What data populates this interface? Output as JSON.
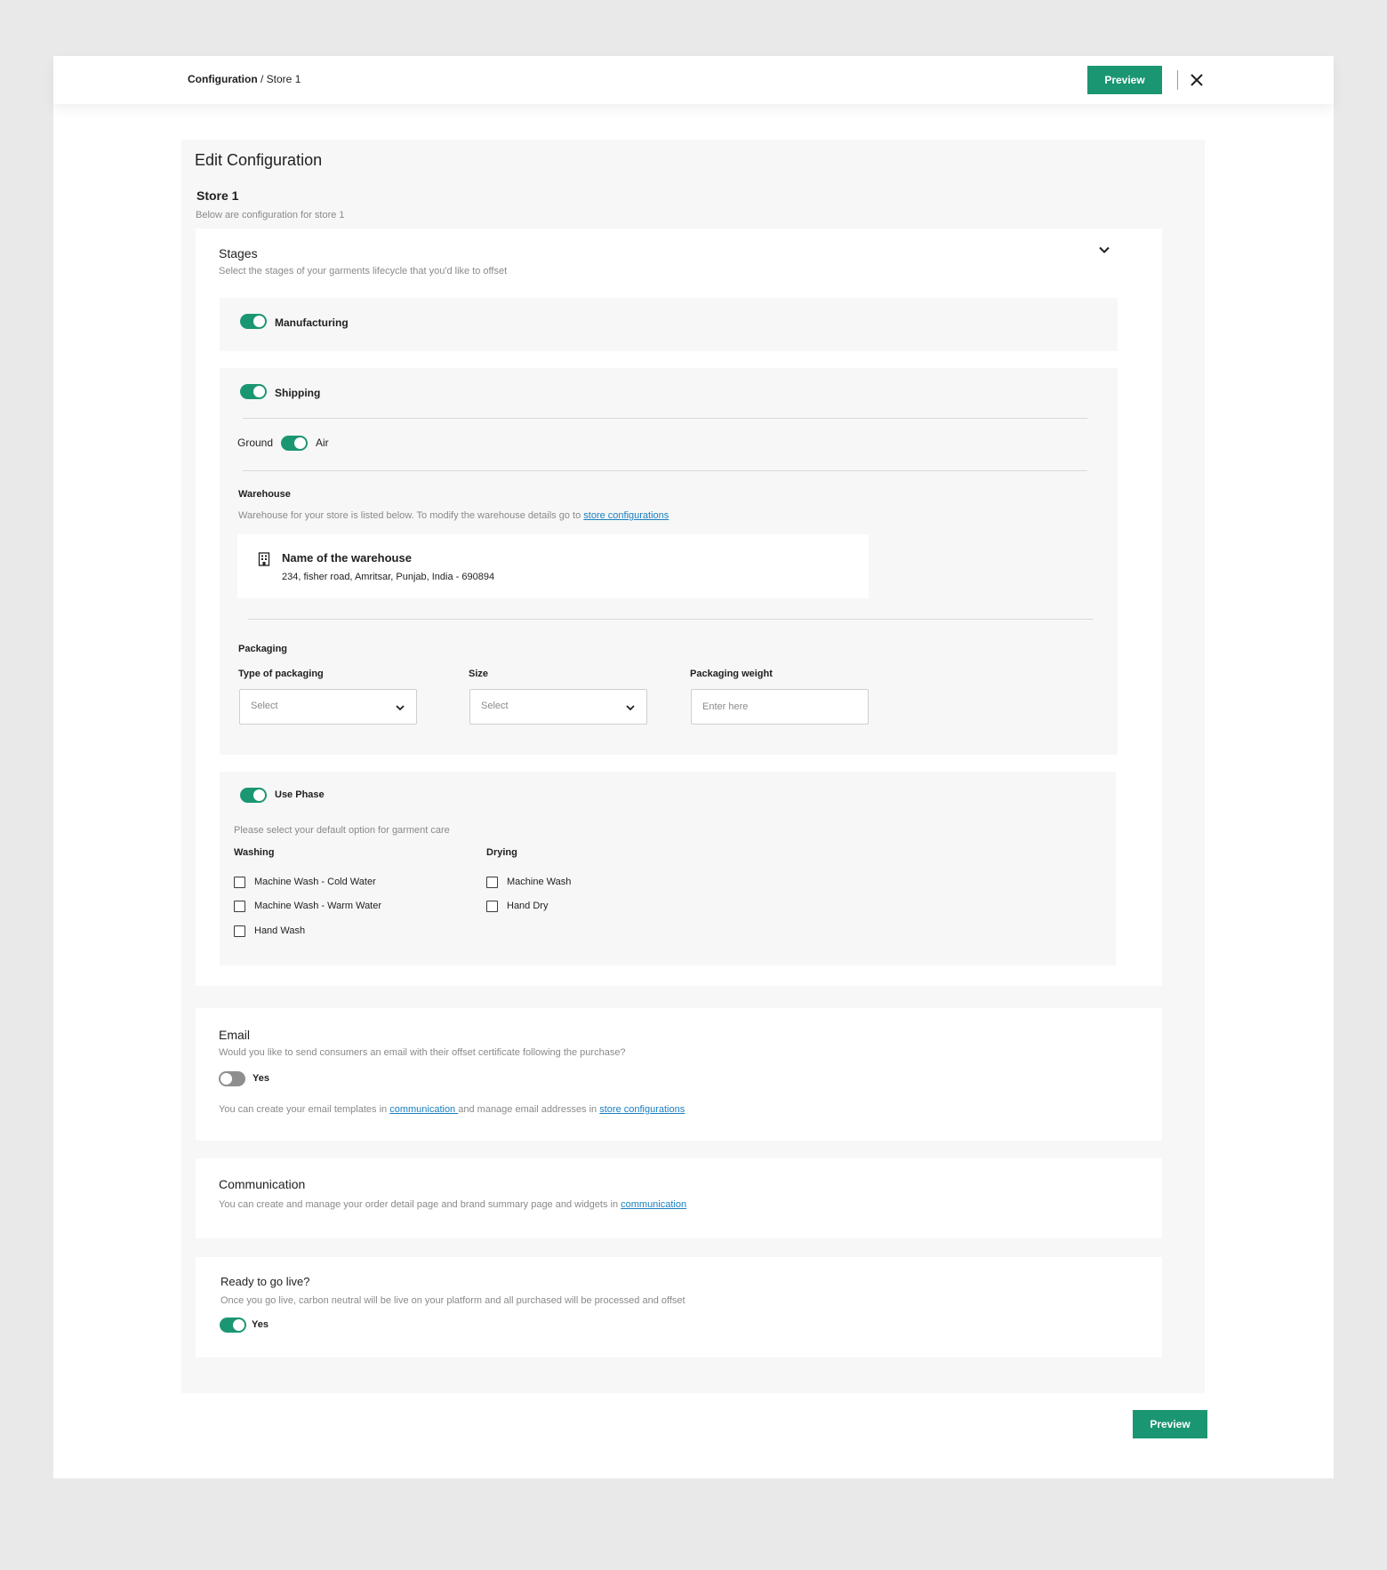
{
  "breadcrumb": {
    "root": "Configuration",
    "separator": " / ",
    "current": "Store 1"
  },
  "header": {
    "preview_label": "Preview"
  },
  "page": {
    "title": "Edit Configuration",
    "store_title": "Store 1",
    "store_subtitle": "Below are configuration for store 1"
  },
  "stages": {
    "title": "Stages",
    "subtitle": "Select the stages of your garments lifecycle that you'd like to offset",
    "manufacturing": {
      "label": "Manufacturing",
      "enabled": true
    },
    "shipping": {
      "label": "Shipping",
      "enabled": true,
      "mode_left": "Ground",
      "mode_right": "Air",
      "mode_selected": "Air",
      "warehouse": {
        "title": "Warehouse",
        "description": "Warehouse for your store is listed below. To modify the warehouse details go to ",
        "link": "store configurations",
        "name": "Name of the warehouse",
        "address": "234, fisher road, Amritsar, Punjab, India - 690894"
      },
      "packaging": {
        "title": "Packaging",
        "type_label": "Type of packaging",
        "type_placeholder": "Select",
        "size_label": "Size",
        "size_placeholder": "Select",
        "weight_label": "Packaging weight",
        "weight_placeholder": "Enter here"
      }
    },
    "use_phase": {
      "label": "Use Phase",
      "enabled": true,
      "description": "Please select your default option for garment care",
      "washing": {
        "title": "Washing",
        "options": [
          "Machine Wash - Cold Water",
          "Machine Wash - Warm Water",
          "Hand Wash"
        ]
      },
      "drying": {
        "title": "Drying",
        "options": [
          "Machine Wash",
          "Hand Dry"
        ]
      }
    }
  },
  "email": {
    "title": "Email",
    "question": "Would you like to send consumers an email with their offset certificate following the purchase?",
    "toggle_label": "Yes",
    "enabled": false,
    "note_prefix": "You can create your email templates in ",
    "note_link1": "communication ",
    "note_middle": "and manage email addresses in ",
    "note_link2": "store configurations"
  },
  "communication": {
    "title": "Communication",
    "note_prefix": "You can create and manage your order detail page and brand summary page and widgets in ",
    "note_link": "communication"
  },
  "go_live": {
    "title": "Ready to go live?",
    "description": "Once you go live, carbon neutral will be live on your platform and all purchased will be processed and offset",
    "toggle_label": "Yes",
    "enabled": true
  },
  "footer": {
    "preview_label": "Preview"
  },
  "colors": {
    "accent": "#1b9673",
    "link": "#1a7fc1",
    "toggle_off": "#8e8e8e"
  }
}
